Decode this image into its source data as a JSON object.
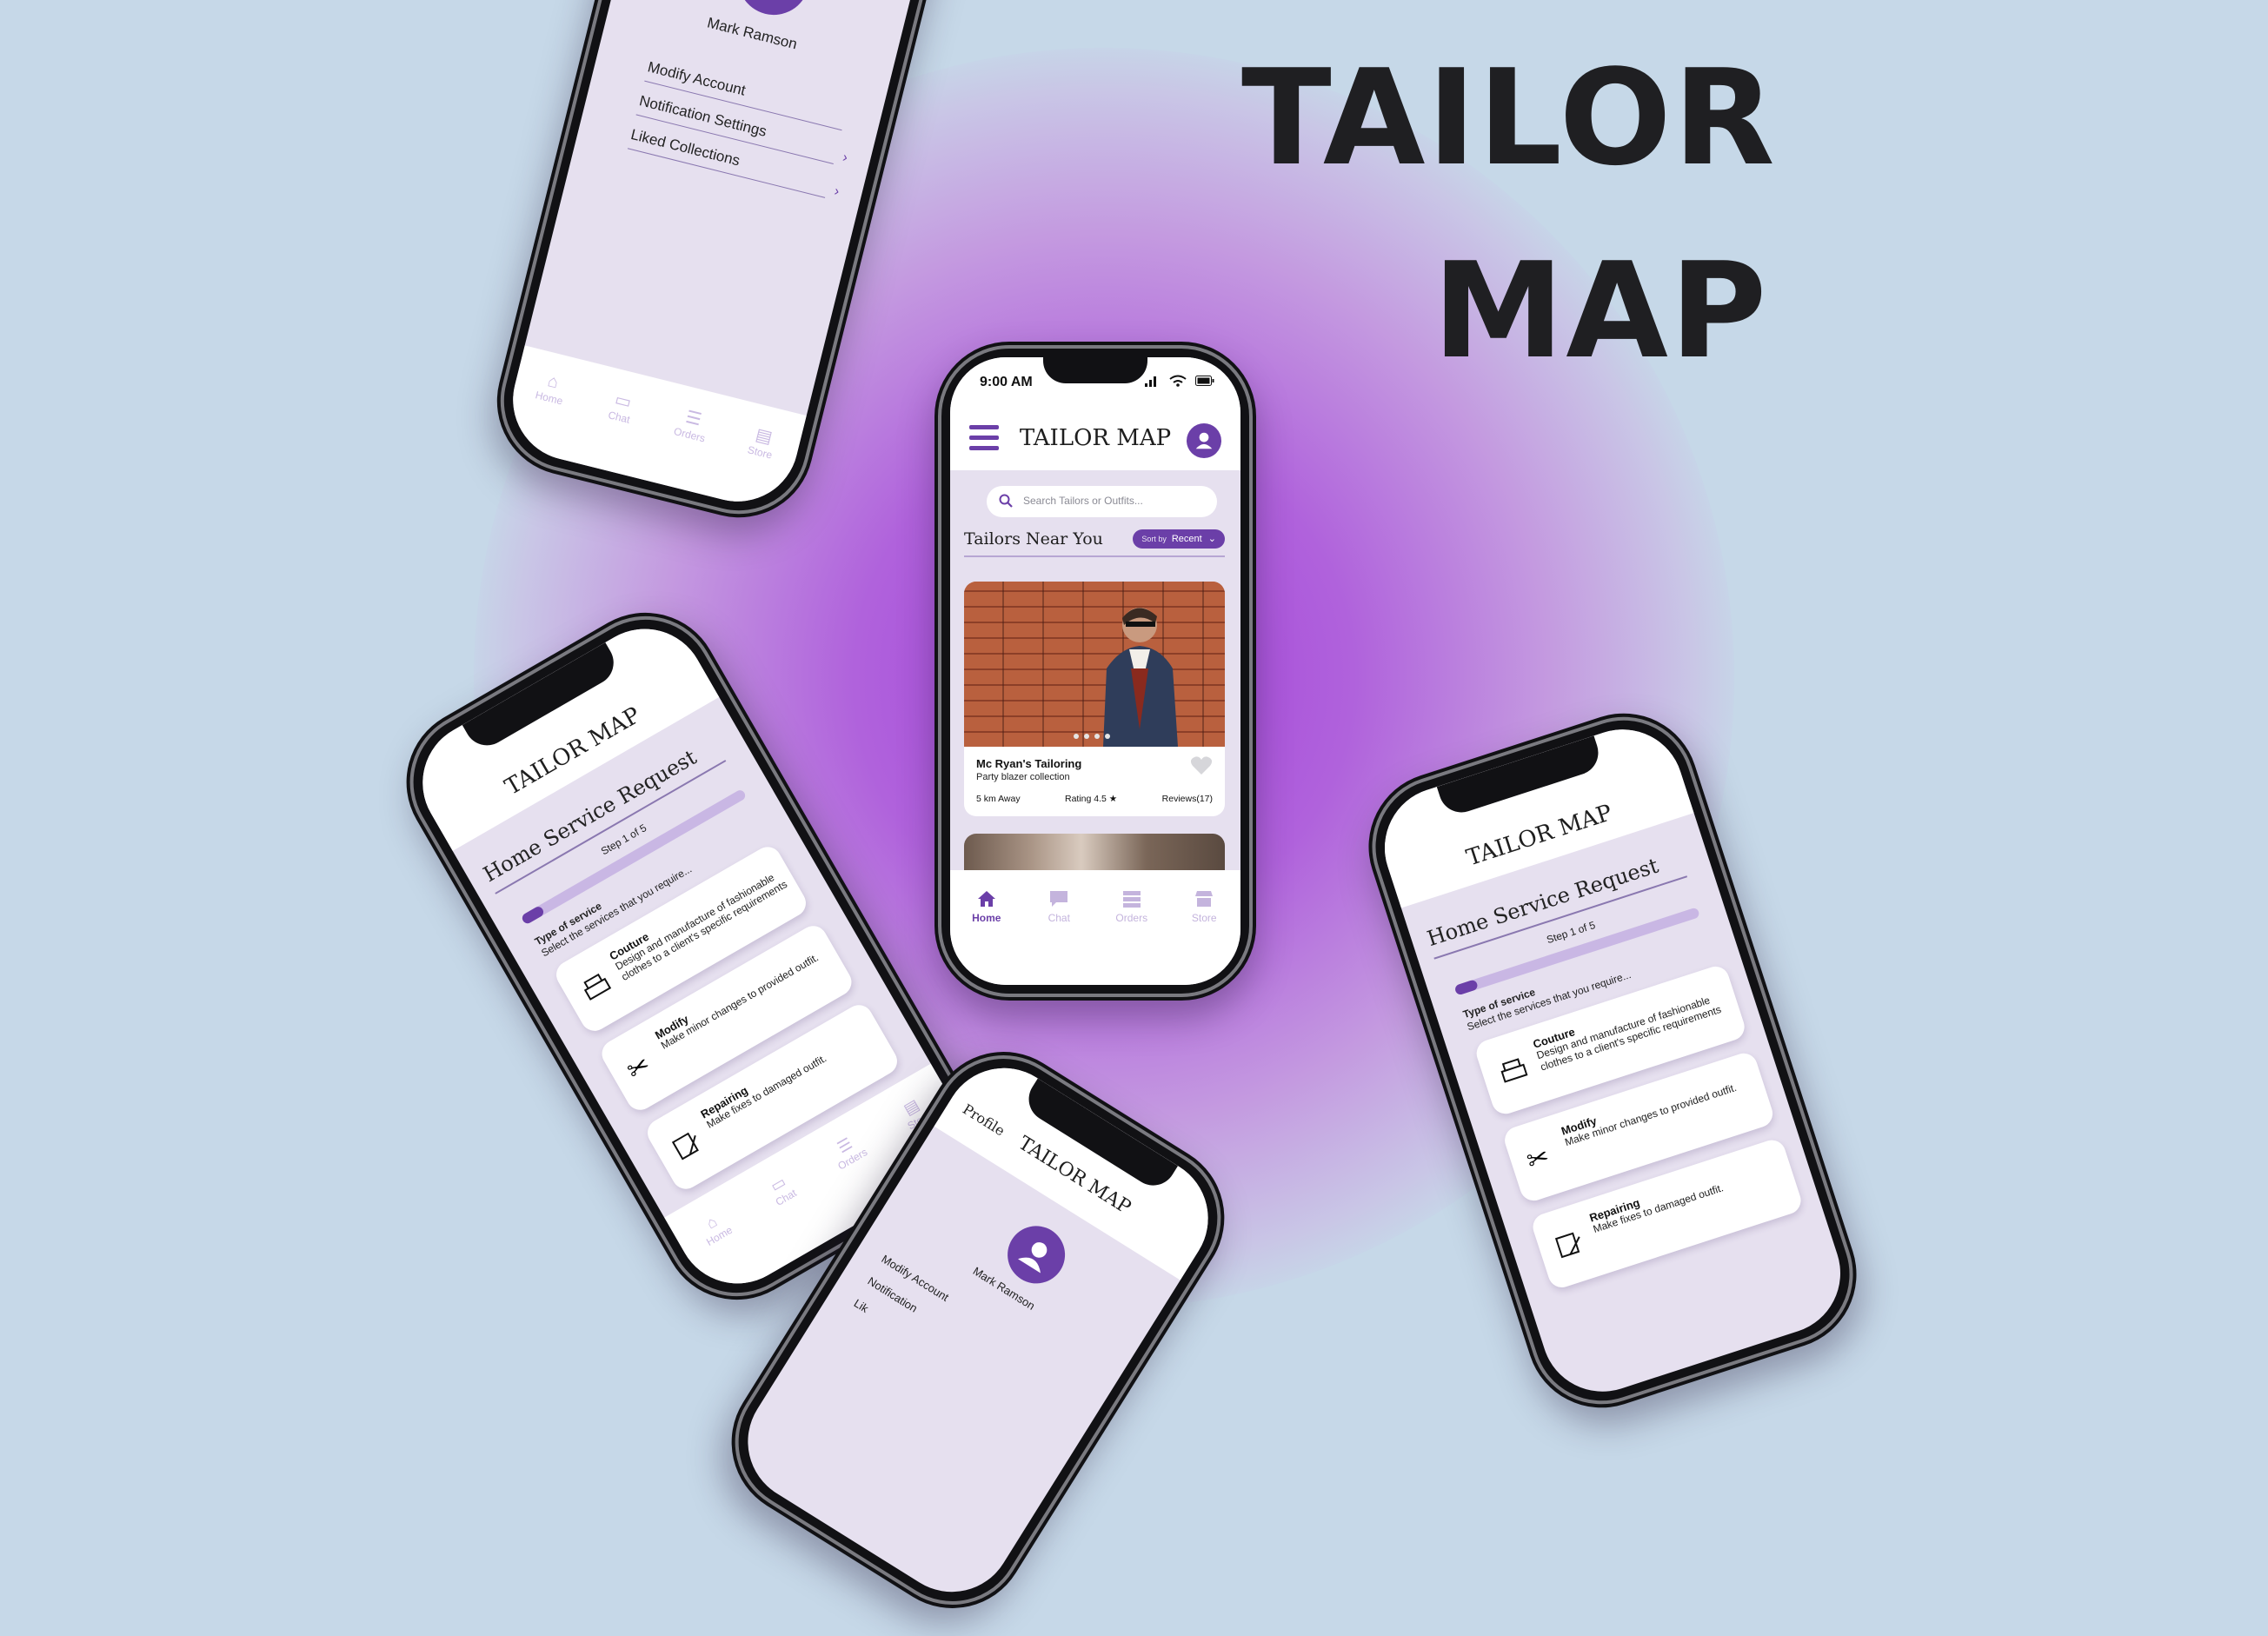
{
  "brand": {
    "line1": "TAILOR",
    "line2": "MAP"
  },
  "main": {
    "time": "9:00 AM",
    "app_title": "TAILOR MAP",
    "search_placeholder": "Search Tailors or Outfits...",
    "section_title": "Tailors Near You",
    "sort_prefix": "Sort by",
    "sort_value": "Recent",
    "card": {
      "name": "Mc Ryan's Tailoring",
      "subtitle": "Party blazer collection",
      "distance": "5 km Away",
      "rating": "Rating 4.5",
      "reviews": "Reviews(17)"
    },
    "nav": [
      {
        "label": "Home"
      },
      {
        "label": "Chat"
      },
      {
        "label": "Orders"
      },
      {
        "label": "Store"
      }
    ]
  },
  "profile_phone": {
    "user": "Mark Ramson",
    "items": [
      "Modify  Account",
      "Notification Settings",
      "Liked Collections"
    ],
    "nav": [
      "Home",
      "Chat",
      "Orders",
      "Store"
    ]
  },
  "request_phone": {
    "app_title": "TAILOR MAP",
    "heading": "Home Service Request",
    "step": "Step 1 of 5",
    "type_label": "Type of service",
    "type_sub": "Select the services that you require...",
    "services": [
      {
        "title": "Couture",
        "desc": "Design and manufacture of fashionable clothes to a client's specific requirements"
      },
      {
        "title": "Modify",
        "desc": "Make minor changes to provided outfit."
      },
      {
        "title": "Repairing",
        "desc": "Make fixes to damaged outfit."
      }
    ],
    "nav": [
      "Home",
      "Chat",
      "Orders",
      "Store"
    ]
  },
  "bottom_phone": {
    "app_title": "TAILOR MAP",
    "label": "Profile",
    "user": "Mark Ramson",
    "items": [
      "Modify Account",
      "Notification",
      "Lik"
    ]
  },
  "colors": {
    "accent": "#6b3fa8",
    "background": "#c6d8e8",
    "glow": "#a240d8"
  }
}
